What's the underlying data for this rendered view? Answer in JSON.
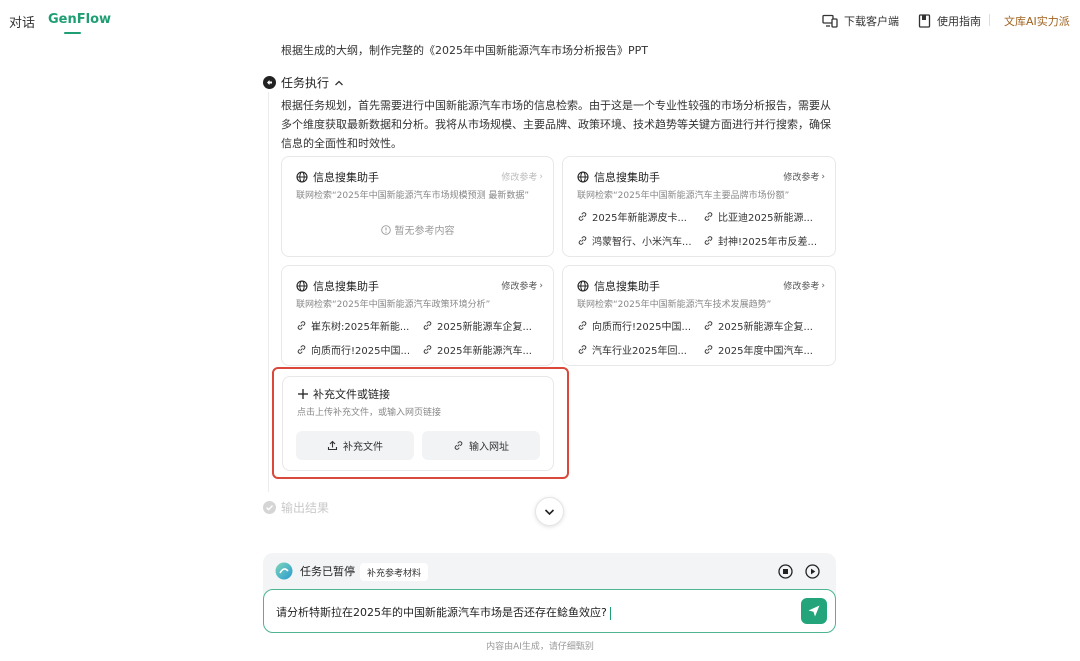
{
  "nav": {
    "tabs": [
      {
        "label": "对话"
      },
      {
        "label": "GenFlow"
      }
    ],
    "download_label": "下载客户端",
    "guide_label": "使用指南",
    "brand_label": "文库AI实力派"
  },
  "content": {
    "intro": "根据生成的大纲，制作完整的《2025年中国新能源汽车市场分析报告》PPT",
    "task_heading": "任务执行",
    "task_desc": "根据任务规划，首先需要进行中国新能源汽车市场的信息检索。由于这是一个专业性较强的市场分析报告，需要从多个维度获取最新数据和分析。我将从市场规模、主要品牌、政策环境、技术趋势等关键方面进行并行搜索，确保信息的全面性和时效性。",
    "cards": [
      {
        "title": "信息搜集助手",
        "edit": "修改参考",
        "query": "联网检索“2025年中国新能源汽车市场规模预测 最新数据”",
        "empty": "暂无参考内容",
        "refs": []
      },
      {
        "title": "信息搜集助手",
        "edit": "修改参考",
        "query": "联网检索“2025年中国新能源汽车主要品牌市场份额”",
        "refs": [
          "2025年新能源皮卡...",
          "比亚迪2025新能源...",
          "鸿蒙智行、小米汽车...",
          "封神!2025年市反差..."
        ]
      },
      {
        "title": "信息搜集助手",
        "edit": "修改参考",
        "query": "联网检索“2025年中国新能源汽车政策环境分析”",
        "refs": [
          "崔东树:2025年新能...",
          "2025新能源车企复...",
          "向质而行!2025中国...",
          "2025年新能源汽车..."
        ]
      },
      {
        "title": "信息搜集助手",
        "edit": "修改参考",
        "query": "联网检索“2025年中国新能源汽车技术发展趋势”",
        "refs": [
          "向质而行!2025中国...",
          "2025新能源车企复...",
          "汽车行业2025年回...",
          "2025年度中国汽车..."
        ]
      }
    ],
    "supplement": {
      "title": "补充文件或链接",
      "desc": "点击上传补充文件，或输入网页链接",
      "upload_label": "补充文件",
      "url_label": "输入网址"
    },
    "output_label": "输出结果"
  },
  "composer": {
    "status": "任务已暂停",
    "chip": "补充参考材料",
    "input_value": "请分析特斯拉在2025年的中国新能源汽车市场是否还存在鲶鱼效应?"
  },
  "footer": {
    "disclaimer": "内容由AI生成，请仔细甄别"
  },
  "colors": {
    "accent": "#1f9e74",
    "highlight_border": "#d9483b",
    "brand": "#a0621f"
  }
}
